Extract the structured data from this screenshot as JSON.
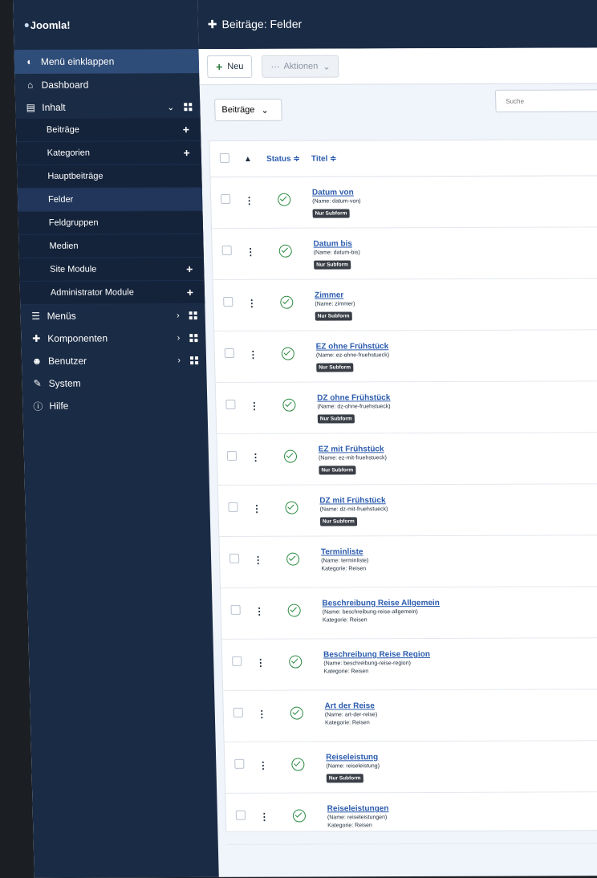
{
  "header": {
    "title": "Beiträge: Felder"
  },
  "toolbar": {
    "new_label": "Neu",
    "actions_label": "Aktionen"
  },
  "filter": {
    "selected": "Beiträge"
  },
  "search": {
    "placeholder": "Suche"
  },
  "sidebar": {
    "logo": "Joomla!",
    "collapse": "Menü einklappen",
    "items": [
      {
        "label": "Dashboard",
        "icon": "home-icon"
      },
      {
        "label": "Inhalt",
        "icon": "file-icon"
      },
      {
        "label": "Menüs",
        "icon": "list-icon"
      },
      {
        "label": "Komponenten",
        "icon": "puzzle-icon"
      },
      {
        "label": "Benutzer",
        "icon": "users-icon"
      },
      {
        "label": "System",
        "icon": "wrench-icon"
      },
      {
        "label": "Hilfe",
        "icon": "info-icon"
      }
    ],
    "content_sub": [
      {
        "label": "Beiträge"
      },
      {
        "label": "Kategorien"
      },
      {
        "label": "Hauptbeiträge"
      },
      {
        "label": "Felder"
      },
      {
        "label": "Feldgruppen"
      },
      {
        "label": "Medien"
      },
      {
        "label": "Site Module"
      },
      {
        "label": "Administrator Module"
      }
    ]
  },
  "table": {
    "headers": {
      "status": "Status ≑",
      "title": "Titel ≑"
    },
    "rows": [
      {
        "title": "Datum von",
        "name": "(Name: datum-von)",
        "badge": "Nur Subform",
        "category": ""
      },
      {
        "title": "Datum bis",
        "name": "(Name: datum-bis)",
        "badge": "Nur Subform",
        "category": ""
      },
      {
        "title": "Zimmer",
        "name": "(Name: zimmer)",
        "badge": "Nur Subform",
        "category": ""
      },
      {
        "title": "EZ ohne Frühstück",
        "name": "(Name: ez-ohne-fruehstueck)",
        "badge": "Nur Subform",
        "category": ""
      },
      {
        "title": "DZ ohne Frühstück",
        "name": "(Name: dz-ohne-fruehstueck)",
        "badge": "Nur Subform",
        "category": ""
      },
      {
        "title": "EZ mit Frühstück",
        "name": "(Name: ez-mit-fruehstueck)",
        "badge": "Nur Subform",
        "category": ""
      },
      {
        "title": "DZ mit Frühstück",
        "name": "(Name: dz-mit-fruehstueck)",
        "badge": "Nur Subform",
        "category": ""
      },
      {
        "title": "Terminliste",
        "name": "(Name: terminliste)",
        "badge": "",
        "category": "Kategorie: Reisen"
      },
      {
        "title": "Beschreibung Reise Allgemein",
        "name": "(Name: beschreibung-reise-allgemein)",
        "badge": "",
        "category": "Kategorie: Reisen"
      },
      {
        "title": "Beschreibung Reise Region",
        "name": "(Name: beschreibung-reise-region)",
        "badge": "",
        "category": "Kategorie: Reisen"
      },
      {
        "title": "Art der Reise",
        "name": "(Name: art-der-reise)",
        "badge": "",
        "category": "Kategorie: Reisen"
      },
      {
        "title": "Reiseleistung",
        "name": "(Name: reiseleistung)",
        "badge": "Nur Subform",
        "category": ""
      },
      {
        "title": "Reiseleistungen",
        "name": "(Name: reiseleistungen)",
        "badge": "",
        "category": "Kategorie: Reisen"
      }
    ]
  }
}
